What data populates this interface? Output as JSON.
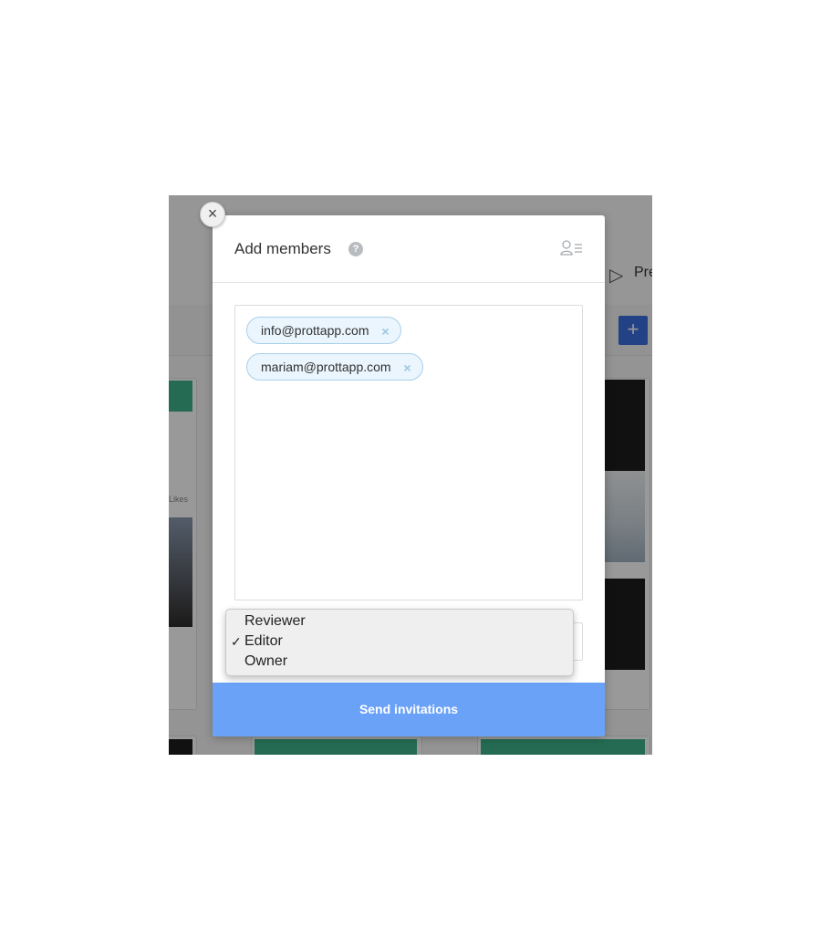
{
  "modal": {
    "title": "Add members",
    "help_icon": "question-circle-icon",
    "header_icon": "member-list-icon",
    "close_label": "×",
    "emails": [
      {
        "text": "info@prottapp.com",
        "remove": "×"
      },
      {
        "text": "mariam@prottapp.com",
        "remove": "×"
      }
    ],
    "send_label": "Send invitations"
  },
  "role_dropdown": {
    "options": [
      "Reviewer",
      "Editor",
      "Owner"
    ],
    "selected": "Editor",
    "check_mark": "✓"
  },
  "background": {
    "toolbar_label": "Pre",
    "likes_label": "Likes",
    "plus_label": "+"
  },
  "colors": {
    "accent": "#6aa2f8",
    "chip_bg": "#eaf5fd",
    "chip_border": "#a9cfe8"
  }
}
